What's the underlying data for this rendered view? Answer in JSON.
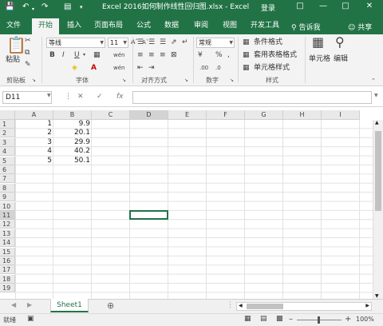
{
  "window": {
    "title": "Excel 2016如何制作线性回归图.xlsx  -  Excel",
    "login": "登录"
  },
  "tabs": [
    "文件",
    "开始",
    "插入",
    "页面布局",
    "公式",
    "数据",
    "审阅",
    "视图",
    "开发工具"
  ],
  "active_tab": "开始",
  "tell_me": "告诉我",
  "share": "共享",
  "ribbon": {
    "paste": "粘贴",
    "font_name": "等线",
    "font_size": "11",
    "number_format": "常规",
    "conditional_format": "条件格式",
    "table_format": "套用表格格式",
    "cell_style": "单元格样式",
    "cells": "单元格",
    "editing": "编辑",
    "groups": [
      "剪贴板",
      "字体",
      "对齐方式",
      "数字",
      "样式"
    ]
  },
  "formula_bar": {
    "name_box": "D11",
    "fx": "fx",
    "value": ""
  },
  "columns": [
    "A",
    "B",
    "C",
    "D",
    "E",
    "F",
    "G",
    "H",
    "I"
  ],
  "rows": [
    "1",
    "2",
    "3",
    "4",
    "5",
    "6",
    "7",
    "8",
    "9",
    "10",
    "11",
    "12",
    "13",
    "14",
    "15",
    "16",
    "17",
    "18",
    "19"
  ],
  "cells": [
    {
      "a": "1",
      "b": "9.9"
    },
    {
      "a": "2",
      "b": "20.1"
    },
    {
      "a": "3",
      "b": "29.9"
    },
    {
      "a": "4",
      "b": "40.2"
    },
    {
      "a": "5",
      "b": "50.1"
    }
  ],
  "sheet_tab": "Sheet1",
  "status": {
    "mode": "就绪",
    "zoom": "100%"
  },
  "colors": {
    "accent": "#217346"
  }
}
